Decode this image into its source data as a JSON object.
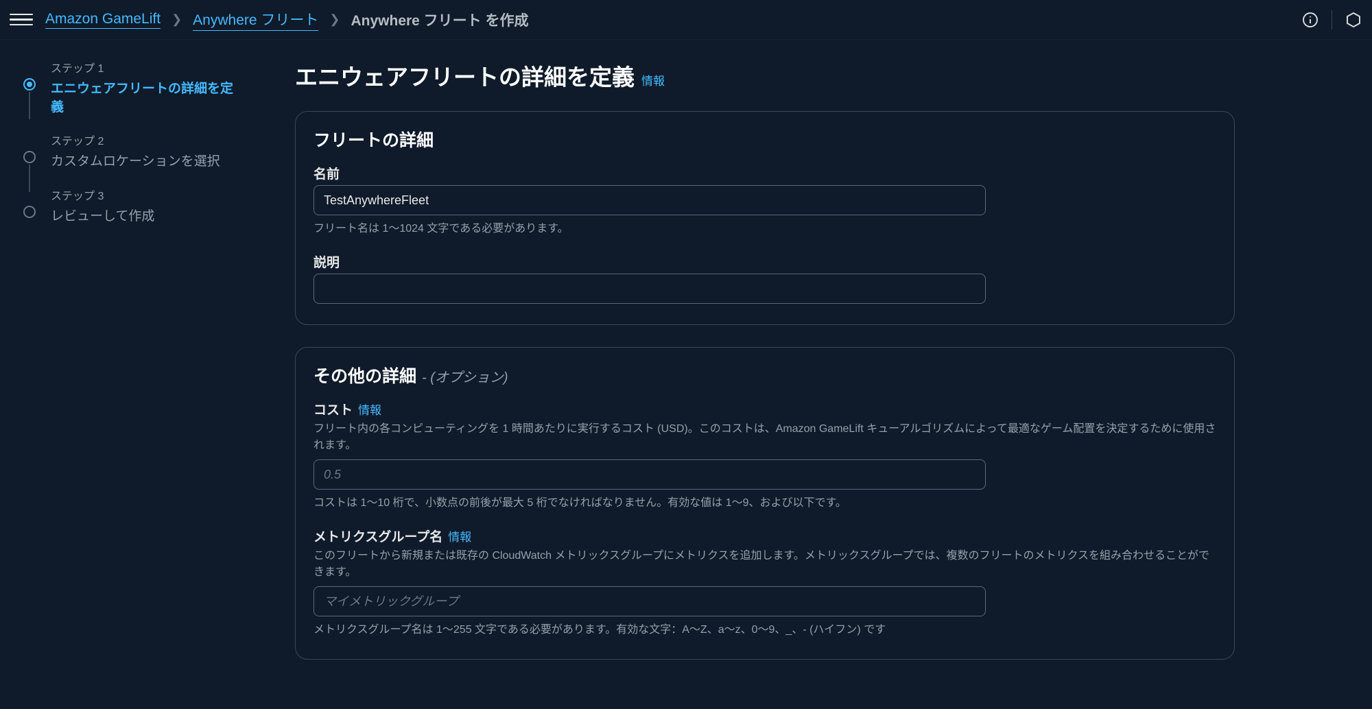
{
  "breadcrumb": {
    "root": "Amazon GameLift",
    "level2": "Anywhere フリート",
    "current": "Anywhere フリート を作成"
  },
  "steps": [
    {
      "num": "ステップ 1",
      "title": "エニウェアフリートの詳細を定義"
    },
    {
      "num": "ステップ 2",
      "title": "カスタムロケーションを選択"
    },
    {
      "num": "ステップ 3",
      "title": "レビューして作成"
    }
  ],
  "page": {
    "title": "エニウェアフリートの詳細を定義",
    "info": "情報"
  },
  "panel_fleet": {
    "title": "フリートの詳細",
    "name": {
      "label": "名前",
      "value": "TestAnywhereFleet",
      "hint": "フリート名は 1〜1024 文字である必要があります。"
    },
    "description": {
      "label": "説明",
      "value": ""
    }
  },
  "panel_other": {
    "title": "その他の詳細",
    "suffix": "- (オプション)",
    "cost": {
      "label": "コスト",
      "info": "情報",
      "desc": "フリート内の各コンピューティングを 1 時間あたりに実行するコスト (USD)。このコストは、Amazon GameLift キューアルゴリズムによって最適なゲーム配置を決定するために使用されます。",
      "placeholder": "0.5",
      "value": "",
      "hint": "コストは 1〜10 桁で、小数点の前後が最大 5 桁でなければなりません。有効な値は 1〜9、および以下です。"
    },
    "metric": {
      "label": "メトリクスグループ名",
      "info": "情報",
      "desc": "このフリートから新規または既存の CloudWatch メトリックスグループにメトリクスを追加します。メトリックスグループでは、複数のフリートのメトリクスを組み合わせることができます。",
      "placeholder": "マイメトリックグループ",
      "value": "",
      "hint": "メトリクスグループ名は 1〜255 文字である必要があります。有効な文字：A〜Z、a〜z、0〜9、_、- (ハイフン) です"
    }
  }
}
